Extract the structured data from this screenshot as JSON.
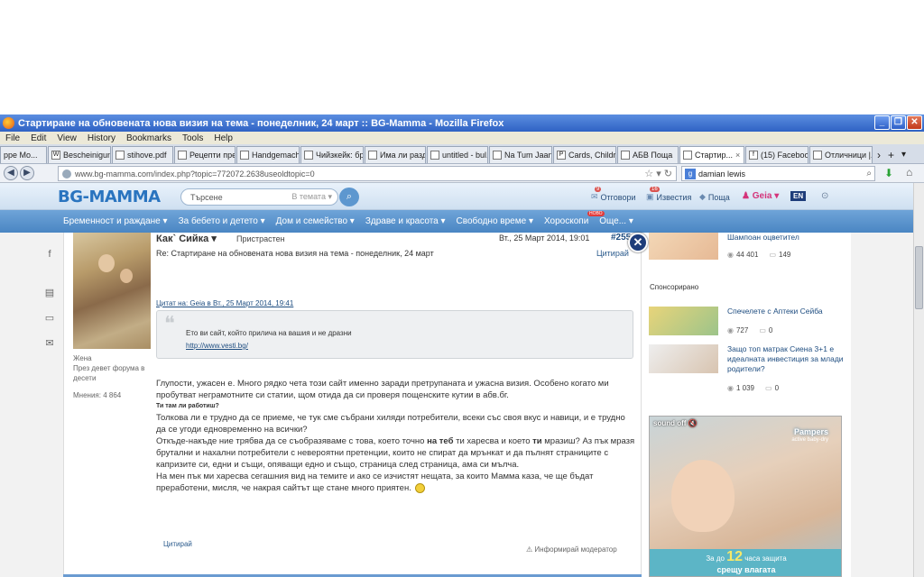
{
  "window": {
    "title": "Стартиране на обновената нова визия на тема - понеделник, 24 март :: BG-Mamma - Mozilla Firefox",
    "min": "_",
    "restore": "❐",
    "close": "✕"
  },
  "menubar": [
    "File",
    "Edit",
    "View",
    "History",
    "Bookmarks",
    "Tools",
    "Help"
  ],
  "tabs": [
    {
      "label": "ppe Mo...",
      "icon": "X"
    },
    {
      "label": "Bescheinigun...",
      "icon": "W"
    },
    {
      "label": "stihove.pdf",
      "icon": ""
    },
    {
      "label": "Рецепти пре...",
      "icon": ""
    },
    {
      "label": "Handgemach...",
      "icon": ""
    },
    {
      "label": "Чийзкейк: бр...",
      "icon": ""
    },
    {
      "label": "Има ли разд...",
      "icon": ""
    },
    {
      "label": "untitled - bul...",
      "icon": ""
    },
    {
      "label": "Na Tum Jaan...",
      "icon": ""
    },
    {
      "label": "Cards, Childr...",
      "icon": "P"
    },
    {
      "label": "АБВ Поща",
      "icon": ""
    },
    {
      "label": "Стартир...",
      "icon": ""
    },
    {
      "label": "(15) Facebook",
      "icon": "f"
    },
    {
      "label": "Отличници |...",
      "icon": ""
    }
  ],
  "tab_controls": {
    "scroll": "›",
    "new": "+",
    "list": "▾"
  },
  "nav": {
    "url": "www.bg-mamma.com/index.php?topic=772072.2638useoldtopic=0",
    "search_value": "damian lewis"
  },
  "site": {
    "logo": "BG-MAMMA",
    "search_placeholder": "Търсене",
    "search_scope": "В темата",
    "links": {
      "answers": "Отговори",
      "answers_badge": "9",
      "notifications": "Известия",
      "notifications_badge": "16",
      "mail": "Поща",
      "user": "Geia",
      "lang": "EN"
    },
    "nav": [
      "Бременност и раждане",
      "За бебето и детето",
      "Дом и семейство",
      "Здраве и красота",
      "Свободно време",
      "Хороскопи",
      "Още..."
    ],
    "nav_new": "НОВО"
  },
  "post": {
    "author": "Как` Сийка ▾",
    "status": "Пристрастен",
    "date": "Вт., 25 Март 2014, 19:01",
    "number": "#255",
    "title": "Re: Стартиране на обновената нова визия на тема - понеделник, 24 март",
    "quote_top": "Цитирай",
    "user_gender": "Жена",
    "user_meta": "През девет форума в десети",
    "user_opinions": "Мнения: 4 864",
    "cite_header": "Цитат на: Geia в Вт., 25 Март 2014, 19:41",
    "quote_text": "Ето ви сайт, който прилича на вашия и не дразни",
    "quote_link": "http://www.vesti.bg/",
    "body_1": "Глупости, ужасен е. Много рядко чета този сайт именно заради претрупаната и ужасна визия. Особено когато ми пробутват неграмотните си статии, щом отида да си проверя пощенските кутии в абв.бг.",
    "body_small": "Ти там ли работиш?",
    "body_2": "Толкова ли е трудно да се приеме, че тук сме събрани хиляди потребители, всеки със своя вкус и навици, и е трудно да се угоди едновременно на всички?",
    "body_3a": "Откъде-накъде ние трябва да се съобразяваме с това, което точно ",
    "body_3b": "на теб",
    "body_3c": " ти харесва и което ",
    "body_3d": "ти",
    "body_3e": " мразиш? Аз пък мразя брутални и нахални потребители с невероятни претенции, които не спират да мрънкат и да пълнят страниците с капризите си, едни и същи, опяващи едно и също, страница след страница, ама си мълча.",
    "body_4": "На мен пък ми харесва сегашния вид на темите и ако се изчистят нещата, за които Мамма каза, че ще бъдат преработени, мисля, че накрая сайтът ще стане много приятен.",
    "quote_bottom": "Цитирай",
    "report": "Информирай модератор"
  },
  "sidebar": {
    "top_title": "Шампоан оцветител",
    "top_views": "44 401",
    "top_comments": "149",
    "sponsored": "Спонсорирано",
    "item1_title": "Спечелете с Аптеки Сейба",
    "item1_views": "727",
    "item1_comments": "0",
    "item2_title": "Защо топ матрак Сиена 3+1 е идеалната инвестиция за млади родители?",
    "item2_views": "1 039",
    "item2_comments": "0",
    "ad_sound": "sound off",
    "ad_brand": "Pampers",
    "ad_brand_sub": "active baby-dry",
    "ad_line1_pre": "За до",
    "ad_line1_num": "12",
    "ad_line1_post": "часа защита",
    "ad_line2": "срещу влагата"
  },
  "colors": {
    "accent": "#4a86c3",
    "link": "#1e4d80",
    "titlebar": "#2f62c4"
  }
}
